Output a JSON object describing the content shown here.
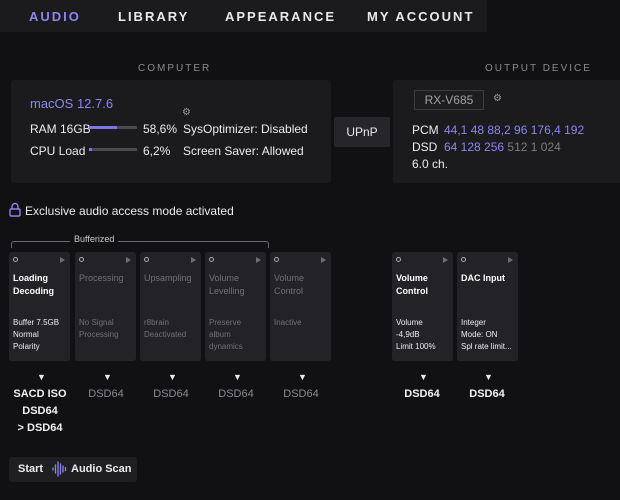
{
  "tabs": [
    "AUDIO",
    "LIBRARY",
    "APPEARANCE",
    "MY ACCOUNT"
  ],
  "computer": {
    "title": "COMPUTER",
    "os": "macOS 12.7.6",
    "gear": "gear-icon",
    "ram_label": "RAM 16GB",
    "ram_value": "58,6%",
    "ram_fraction": 0.586,
    "cpu_label": "CPU Load",
    "cpu_value": "6,2%",
    "cpu_fraction": 0.062,
    "sysopt": "SysOptimizer: Disabled",
    "screensaver": "Screen Saver: Allowed"
  },
  "upnp": "UPnP",
  "output": {
    "title": "OUTPUT DEVICE",
    "device": "RX-V685",
    "pcm_label": "PCM",
    "pcm_rates": "44,1 48 88,2 96 176,4 192",
    "dsd_label": "DSD",
    "dsd_supported": "64 128 256",
    "dsd_unsupported": "512 1 024",
    "channels": "6.0 ch."
  },
  "exclusive": "Exclusive audio access mode activated",
  "bufferized": "Bufferized",
  "pipeline": [
    {
      "title1": "Loading",
      "title2": "Decoding",
      "d1": "Buffer 7.5GB",
      "d2": "Normal",
      "d3": "Polarity",
      "d4": "",
      "active": true
    },
    {
      "title1": "Processing",
      "title2": "",
      "d1": "No Signal",
      "d2": "Processing",
      "d3": "",
      "d4": "",
      "active": false
    },
    {
      "title1": "Upsampling",
      "title2": "",
      "d1": "r8brain",
      "d2": "Deactivated",
      "d3": "",
      "d4": "",
      "active": false
    },
    {
      "title1": "Volume",
      "title2": "Levelling",
      "d1": "Preserve",
      "d2": "album",
      "d3": "dynamics",
      "d4": "",
      "active": false
    },
    {
      "title1": "Volume",
      "title2": "Control",
      "d1": "Inactive",
      "d2": "",
      "d3": "",
      "d4": "",
      "active": false
    },
    {
      "title1": "Volume",
      "title2": "Control",
      "d1": "Volume",
      "d2": "-4,9dB",
      "d3": "Limit 100%",
      "d4": "",
      "active": true
    },
    {
      "title1": "DAC Input",
      "title2": "",
      "d1": "Integer",
      "d2": "Mode: ON",
      "d3": "Spl rate limit...",
      "d4": "",
      "active": true
    }
  ],
  "formats": [
    {
      "l1": "SACD ISO",
      "l2": "DSD64",
      "l3": "> DSD64",
      "active": true
    },
    {
      "l1": "DSD64",
      "l2": "",
      "l3": "",
      "active": false
    },
    {
      "l1": "DSD64",
      "l2": "",
      "l3": "",
      "active": false
    },
    {
      "l1": "DSD64",
      "l2": "",
      "l3": "",
      "active": false
    },
    {
      "l1": "DSD64",
      "l2": "",
      "l3": "",
      "active": false
    },
    {
      "l1": "DSD64",
      "l2": "",
      "l3": "",
      "active": true
    },
    {
      "l1": "DSD64",
      "l2": "",
      "l3": "",
      "active": true
    }
  ],
  "start": "Start",
  "audio_scan": "Audio Scan",
  "colors": {
    "accent": "#8b86f3",
    "background": "#111113",
    "panel": "#1b1b1e"
  }
}
